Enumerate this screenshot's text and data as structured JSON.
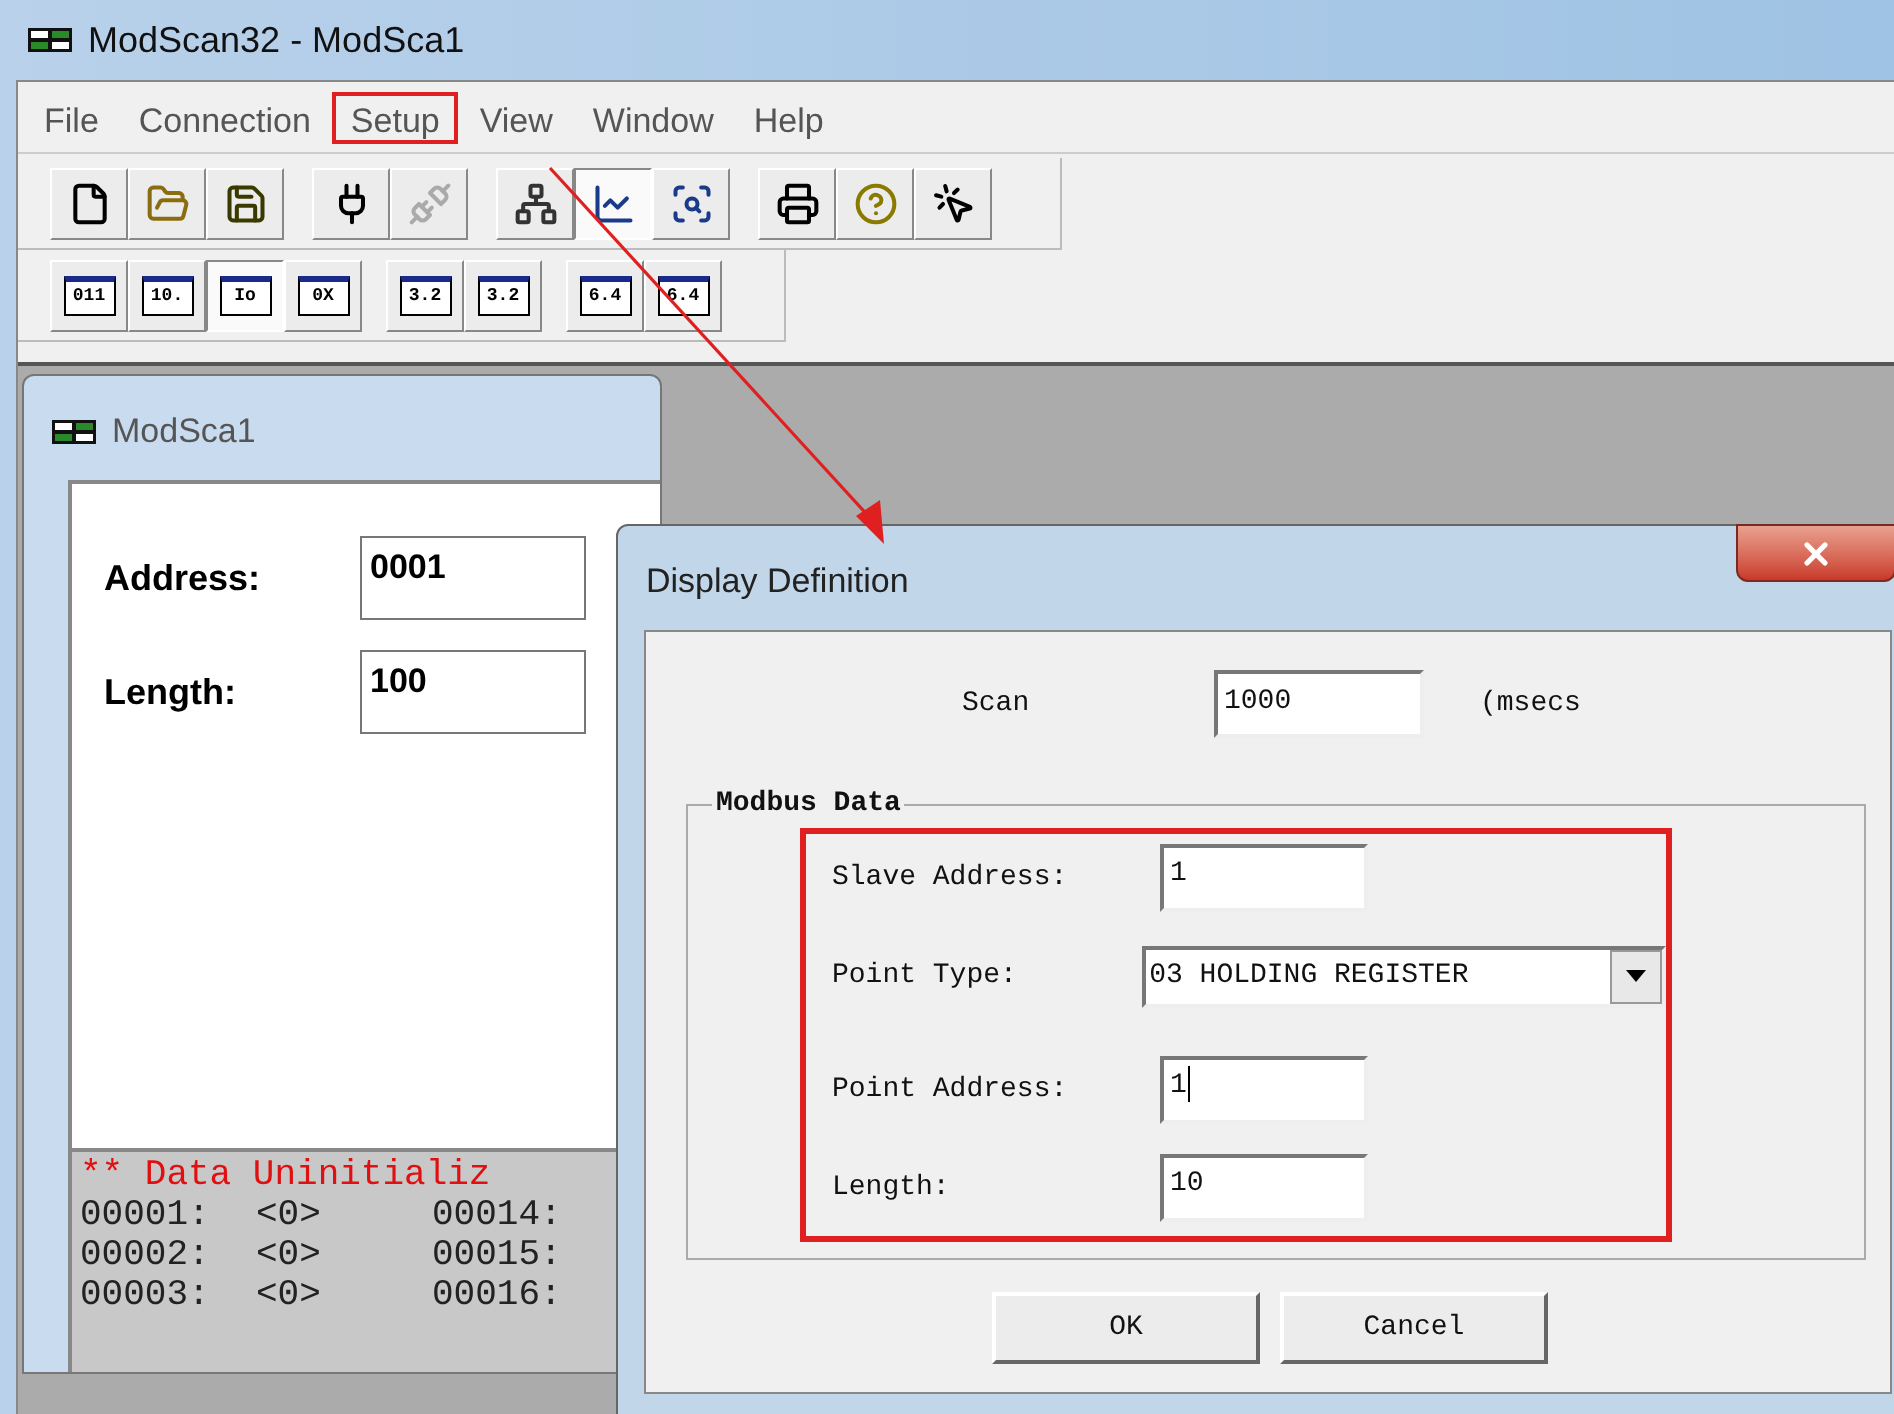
{
  "window": {
    "title": "ModScan32 - ModSca1"
  },
  "menu": [
    {
      "label": "File",
      "highlighted": false
    },
    {
      "label": "Connection",
      "highlighted": false
    },
    {
      "label": "Setup",
      "highlighted": true
    },
    {
      "label": "View",
      "highlighted": false
    },
    {
      "label": "Window",
      "highlighted": false
    },
    {
      "label": "Help",
      "highlighted": false
    }
  ],
  "toolbar": [
    [
      {
        "kind": "new",
        "disabled": false,
        "selected": false
      },
      {
        "kind": "open",
        "disabled": false,
        "selected": false
      },
      {
        "kind": "save",
        "disabled": false,
        "selected": false
      }
    ],
    [
      {
        "kind": "connect",
        "disabled": false,
        "selected": false
      },
      {
        "kind": "disconnect",
        "disabled": true,
        "selected": false
      }
    ],
    [
      {
        "kind": "setup",
        "disabled": false,
        "selected": false
      },
      {
        "kind": "display",
        "disabled": false,
        "selected": true
      },
      {
        "kind": "view",
        "disabled": false,
        "selected": false
      }
    ],
    [
      {
        "kind": "print",
        "disabled": false,
        "selected": false
      },
      {
        "kind": "help",
        "disabled": false,
        "selected": false
      },
      {
        "kind": "context-help",
        "disabled": false,
        "selected": false
      }
    ]
  ],
  "format_toolbar": [
    [
      {
        "label": "011",
        "selected": false
      },
      {
        "label": "10.",
        "selected": false
      },
      {
        "label": "Io",
        "selected": true
      },
      {
        "label": "0X",
        "selected": false
      }
    ],
    [
      {
        "label": "3.2",
        "selected": false
      },
      {
        "label": "3.2",
        "selected": false
      }
    ],
    [
      {
        "label": "6.4",
        "selected": false
      },
      {
        "label": "6.4",
        "selected": false
      }
    ]
  ],
  "child_window": {
    "title": "ModSca1",
    "fields": [
      {
        "label": "Address:",
        "value": "0001"
      },
      {
        "label": "Length:",
        "value": "100"
      }
    ],
    "status": "** Data Uninitializ",
    "data_rows": [
      [
        "00001:",
        "<0>",
        "00014:"
      ],
      [
        "00002:",
        "<0>",
        "00015:"
      ],
      [
        "00003:",
        "<0>",
        "00016:"
      ]
    ]
  },
  "dialog": {
    "title": "Display Definition",
    "scan": {
      "label": "Scan",
      "value": "1000",
      "unit": "(msecs"
    },
    "modbus_data": {
      "legend": "Modbus Data",
      "highlighted": true,
      "fields": [
        {
          "kind": "text",
          "label": "Slave Address:",
          "value": "1",
          "focused": false
        },
        {
          "kind": "select",
          "label": "Point Type:",
          "value": "03 HOLDING REGISTER"
        },
        {
          "kind": "text",
          "label": "Point Address:",
          "value": "1",
          "focused": true
        },
        {
          "kind": "text",
          "label": "Length:",
          "value": "10",
          "focused": false
        }
      ]
    },
    "buttons": [
      "OK",
      "Cancel"
    ]
  }
}
